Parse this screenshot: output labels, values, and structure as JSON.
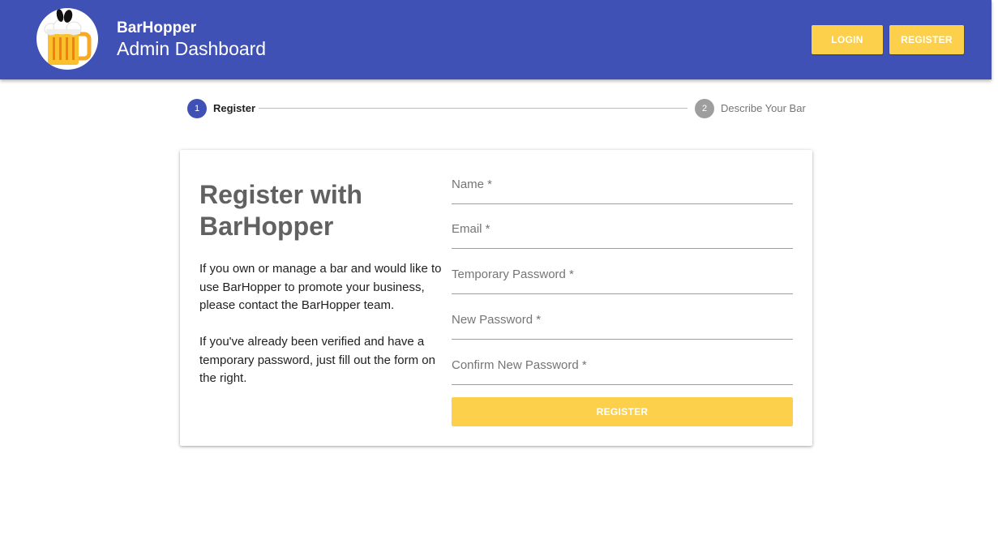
{
  "header": {
    "brand_name": "BarHopper",
    "subtitle": "Admin Dashboard",
    "login_label": "LOGIN",
    "register_label": "REGISTER",
    "logo_icon": "beer-mug-icon"
  },
  "stepper": {
    "steps": [
      {
        "number": "1",
        "label": "Register",
        "active": true
      },
      {
        "number": "2",
        "label": "Describe Your Bar",
        "active": false
      }
    ]
  },
  "card": {
    "title": "Register with BarHopper",
    "paragraph1": "If you own or manage a bar and would like to use BarHopper to promote your business, please contact the BarHopper team.",
    "paragraph2": "If you've already been verified and have a temporary password, just fill out the form on the right."
  },
  "form": {
    "fields": [
      {
        "label": "Name *",
        "value": ""
      },
      {
        "label": "Email *",
        "value": ""
      },
      {
        "label": "Temporary Password *",
        "value": ""
      },
      {
        "label": "New Password *",
        "value": ""
      },
      {
        "label": "Confirm New Password *",
        "value": ""
      }
    ],
    "submit_label": "REGISTER"
  },
  "colors": {
    "primary": "#3f51b5",
    "accent": "#fdd04b",
    "inactive_step": "#9e9e9e"
  }
}
